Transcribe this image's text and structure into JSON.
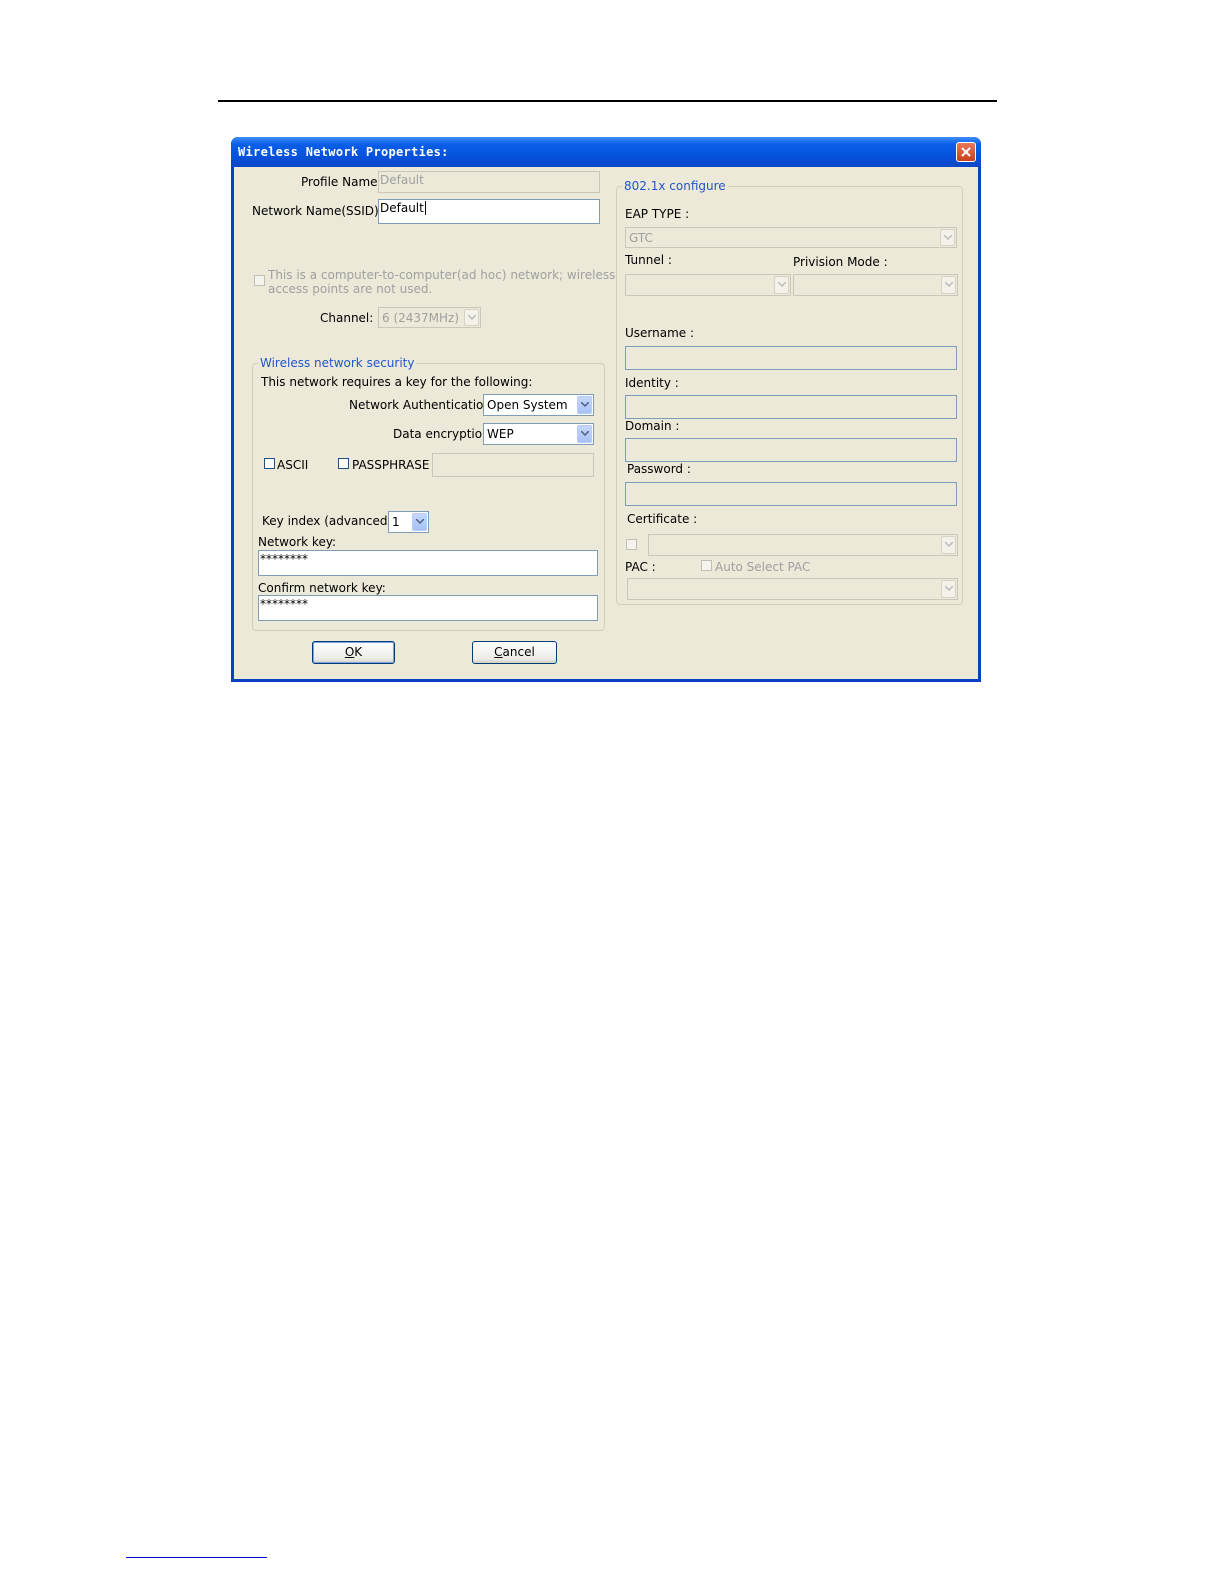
{
  "window": {
    "title": "Wireless Network Properties:"
  },
  "profile": {
    "label": "Profile Name:",
    "value": "Default"
  },
  "ssid": {
    "label": "Network Name(SSID):",
    "value": "Default"
  },
  "adhoc": {
    "label_line1": "This is a computer-to-computer(ad hoc) network; wireless",
    "label_line2": "access points are not used."
  },
  "channel": {
    "label": "Channel:",
    "value": "6  (2437MHz)"
  },
  "security": {
    "legend": "Wireless network security",
    "requires_label": "This network requires a key for the following:",
    "auth_label": "Network Authentication:",
    "auth_value": "Open System",
    "enc_label": "Data encryption:",
    "enc_value": "WEP",
    "ascii_label": "ASCII",
    "passphrase_label": "PASSPHRASE",
    "key_index_label": "Key index (advanced):",
    "key_index_value": "1",
    "network_key_label": "Network key:",
    "network_key_value": "********",
    "confirm_key_label": "Confirm network key:",
    "confirm_key_value": "********"
  },
  "dot1x": {
    "legend": "802.1x configure",
    "eap_label": "EAP TYPE :",
    "eap_value": "GTC",
    "tunnel_label": "Tunnel :",
    "provision_label": "Privision Mode :",
    "username_label": "Username :",
    "identity_label": "Identity :",
    "domain_label": "Domain :",
    "password_label": "Password :",
    "certificate_label": "Certificate :",
    "pac_label": "PAC :",
    "auto_pac_label": "Auto Select PAC"
  },
  "buttons": {
    "ok_mnemonic": "O",
    "ok_rest": "K",
    "cancel_mnemonic": "C",
    "cancel_rest": "ancel"
  }
}
